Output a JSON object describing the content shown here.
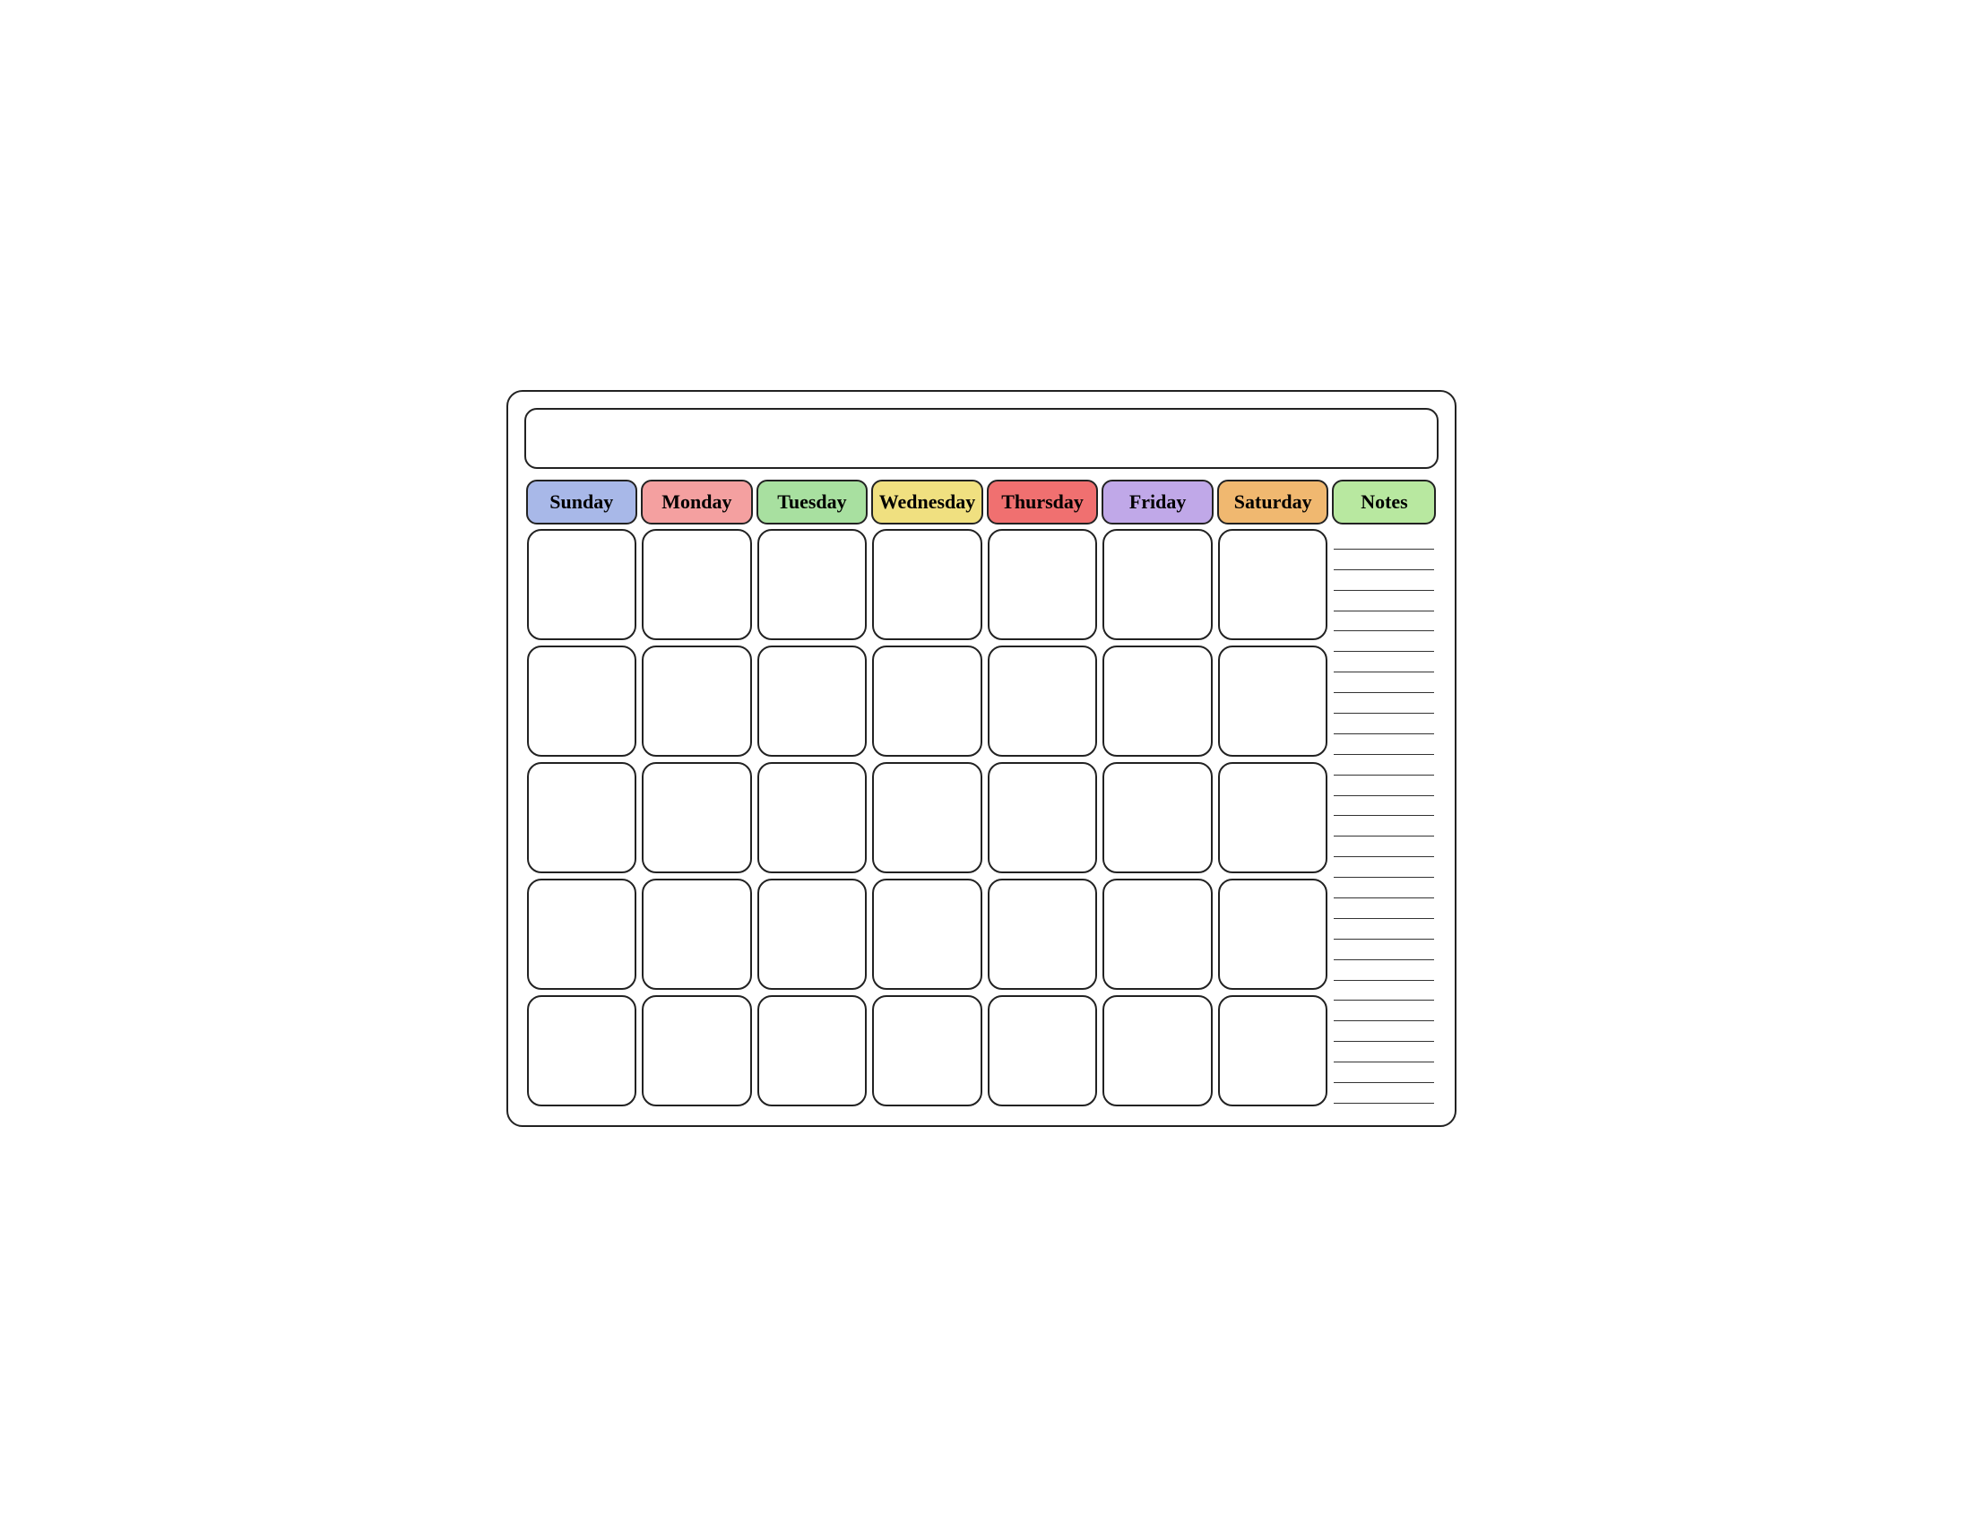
{
  "calendar": {
    "title": "",
    "days": [
      {
        "label": "Sunday",
        "colorClass": "header-sunday"
      },
      {
        "label": "Monday",
        "colorClass": "header-monday"
      },
      {
        "label": "Tuesday",
        "colorClass": "header-tuesday"
      },
      {
        "label": "Wednesday",
        "colorClass": "header-wednesday"
      },
      {
        "label": "Thursday",
        "colorClass": "header-thursday"
      },
      {
        "label": "Friday",
        "colorClass": "header-friday"
      },
      {
        "label": "Saturday",
        "colorClass": "header-saturday"
      }
    ],
    "notes_label": "Notes",
    "notes_header_color": "header-notes",
    "rows": 5,
    "notes_lines": 28
  }
}
